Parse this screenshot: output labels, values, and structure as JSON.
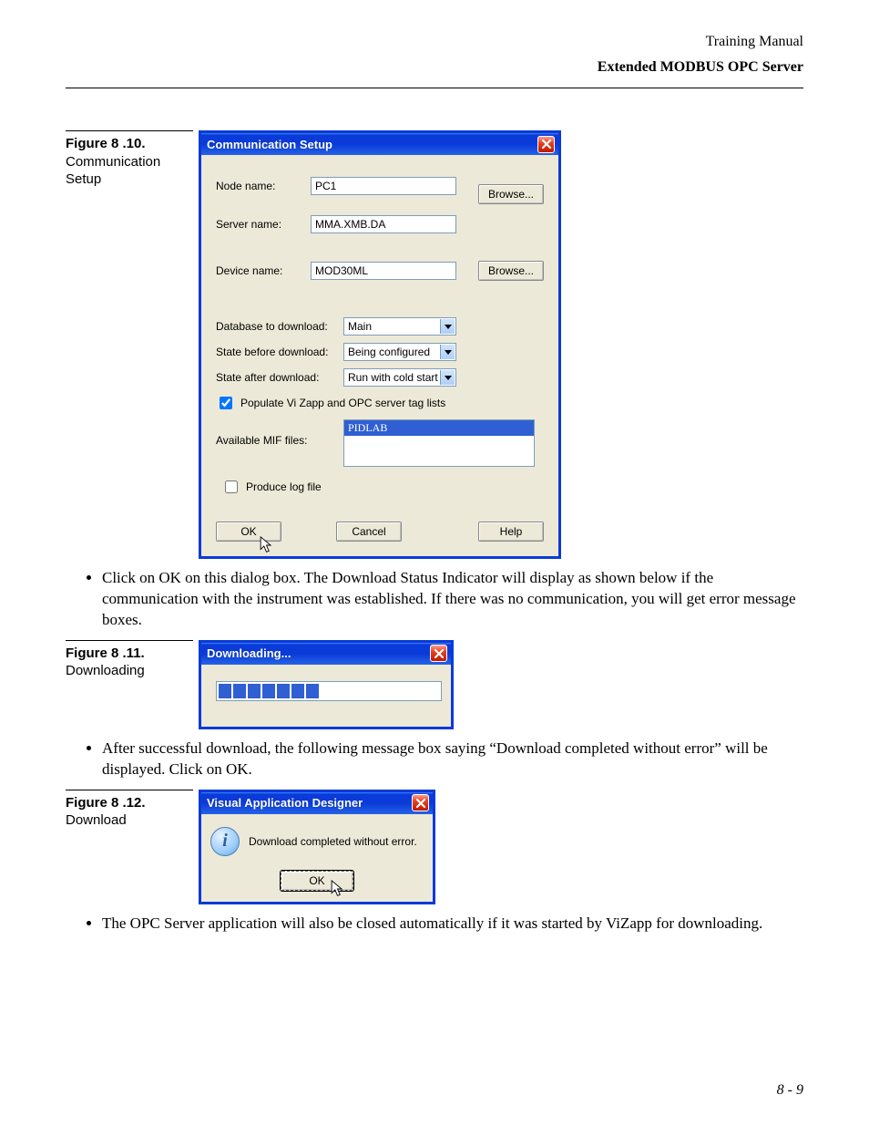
{
  "header": {
    "line1": "Training Manual",
    "line2": "Extended MODBUS OPC Server"
  },
  "figures": {
    "f810": {
      "label": "Figure 8 .10.",
      "caption": "Communication Setup"
    },
    "f811": {
      "label": "Figure 8 .11.",
      "caption": "Downloading"
    },
    "f812": {
      "label": "Figure 8 .12.",
      "caption": "Download"
    }
  },
  "commSetup": {
    "title": "Communication Setup",
    "labels": {
      "node": "Node name:",
      "server": "Server name:",
      "device": "Device name:",
      "db": "Database to download:",
      "before": "State before download:",
      "after": "State after download:",
      "populate": "Populate Vi Zapp and OPC server tag lists",
      "mif": "Available MIF files:",
      "log": "Produce log file"
    },
    "values": {
      "node": "PC1",
      "server": "MMA.XMB.DA",
      "device": "MOD30ML",
      "db": "Main",
      "before": "Being configured",
      "after": "Run with cold start",
      "selectedMif": "PIDLAB"
    },
    "buttons": {
      "browse": "Browse...",
      "ok": "OK",
      "cancel": "Cancel",
      "help": "Help"
    }
  },
  "bullets": {
    "b1": "Click on OK on this dialog box. The Download Status Indicator will display as shown below if the communication with the instrument was established. If there was no communication, you will get error message boxes.",
    "b2": "After successful download, the following message box saying “Download completed without error” will be displayed. Click on OK.",
    "b3": "The OPC Server application will also be closed automatically if it was started by ViZapp for downloading."
  },
  "downloading": {
    "title": "Downloading..."
  },
  "infoBox": {
    "title": "Visual Application Designer",
    "message": "Download completed without error.",
    "ok": "OK"
  },
  "pageNumber": "8 - 9"
}
